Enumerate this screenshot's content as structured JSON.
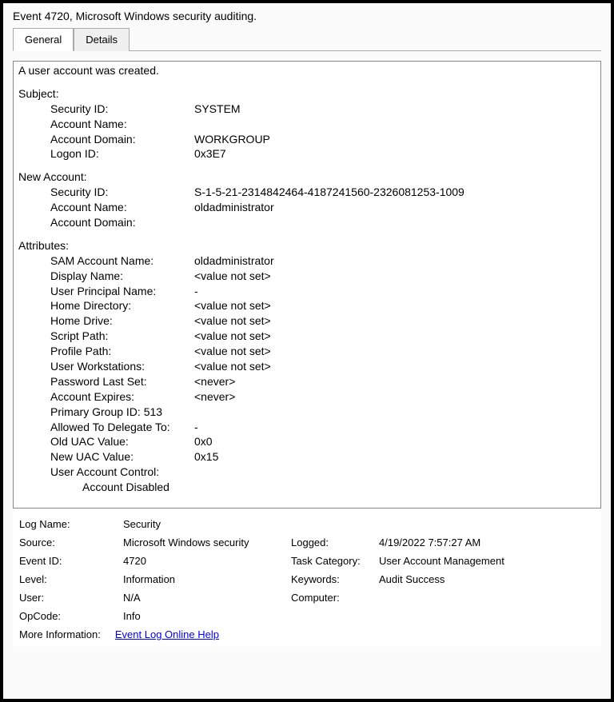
{
  "title": "Event 4720, Microsoft Windows security auditing.",
  "tabs": {
    "general": "General",
    "details": "Details"
  },
  "body": {
    "headline": "A user account was created.",
    "subject_label": "Subject:",
    "subject": {
      "security_id_k": "Security ID:",
      "security_id_v": "SYSTEM",
      "account_name_k": "Account Name:",
      "account_name_v": "",
      "account_domain_k": "Account Domain:",
      "account_domain_v": "WORKGROUP",
      "logon_id_k": "Logon ID:",
      "logon_id_v": "0x3E7"
    },
    "new_account_label": "New Account:",
    "new_account": {
      "security_id_k": "Security ID:",
      "security_id_v": "S-1-5-21-2314842464-4187241560-2326081253-1009",
      "account_name_k": "Account Name:",
      "account_name_v": "oldadministrator",
      "account_domain_k": "Account Domain:",
      "account_domain_v": ""
    },
    "attributes_label": "Attributes:",
    "attributes": {
      "sam_k": "SAM Account Name:",
      "sam_v": "oldadministrator",
      "display_k": "Display Name:",
      "display_v": "<value not set>",
      "upn_k": "User Principal Name:",
      "upn_v": "-",
      "homedir_k": "Home Directory:",
      "homedir_v": "<value not set>",
      "homedrive_k": "Home Drive:",
      "homedrive_v": "<value not set>",
      "script_k": "Script Path:",
      "script_v": "<value not set>",
      "profile_k": "Profile Path:",
      "profile_v": "<value not set>",
      "ws_k": "User Workstations:",
      "ws_v": "<value not set>",
      "pwset_k": "Password Last Set:",
      "pwset_v": "<never>",
      "expires_k": "Account Expires:",
      "expires_v": "<never>",
      "pgroup_k": "Primary Group ID: 513",
      "delegate_k": "Allowed To Delegate To:",
      "delegate_v": "-",
      "olduac_k": "Old UAC Value:",
      "olduac_v": "0x0",
      "newuac_k": "New UAC Value:",
      "newuac_v": "0x15",
      "uac_k": "User Account Control:",
      "uac_sub1": "Account Disabled"
    }
  },
  "meta": {
    "log_name_k": "Log Name:",
    "log_name_v": "Security",
    "source_k": "Source:",
    "source_v": "Microsoft Windows security",
    "logged_k": "Logged:",
    "logged_v": "4/19/2022 7:57:27 AM",
    "event_id_k": "Event ID:",
    "event_id_v": "4720",
    "task_cat_k": "Task Category:",
    "task_cat_v": "User Account Management",
    "level_k": "Level:",
    "level_v": "Information",
    "keywords_k": "Keywords:",
    "keywords_v": "Audit Success",
    "user_k": "User:",
    "user_v": "N/A",
    "computer_k": "Computer:",
    "computer_v": "",
    "opcode_k": "OpCode:",
    "opcode_v": "Info",
    "more_info_k": "More Information:",
    "more_info_link": "Event Log Online Help"
  }
}
